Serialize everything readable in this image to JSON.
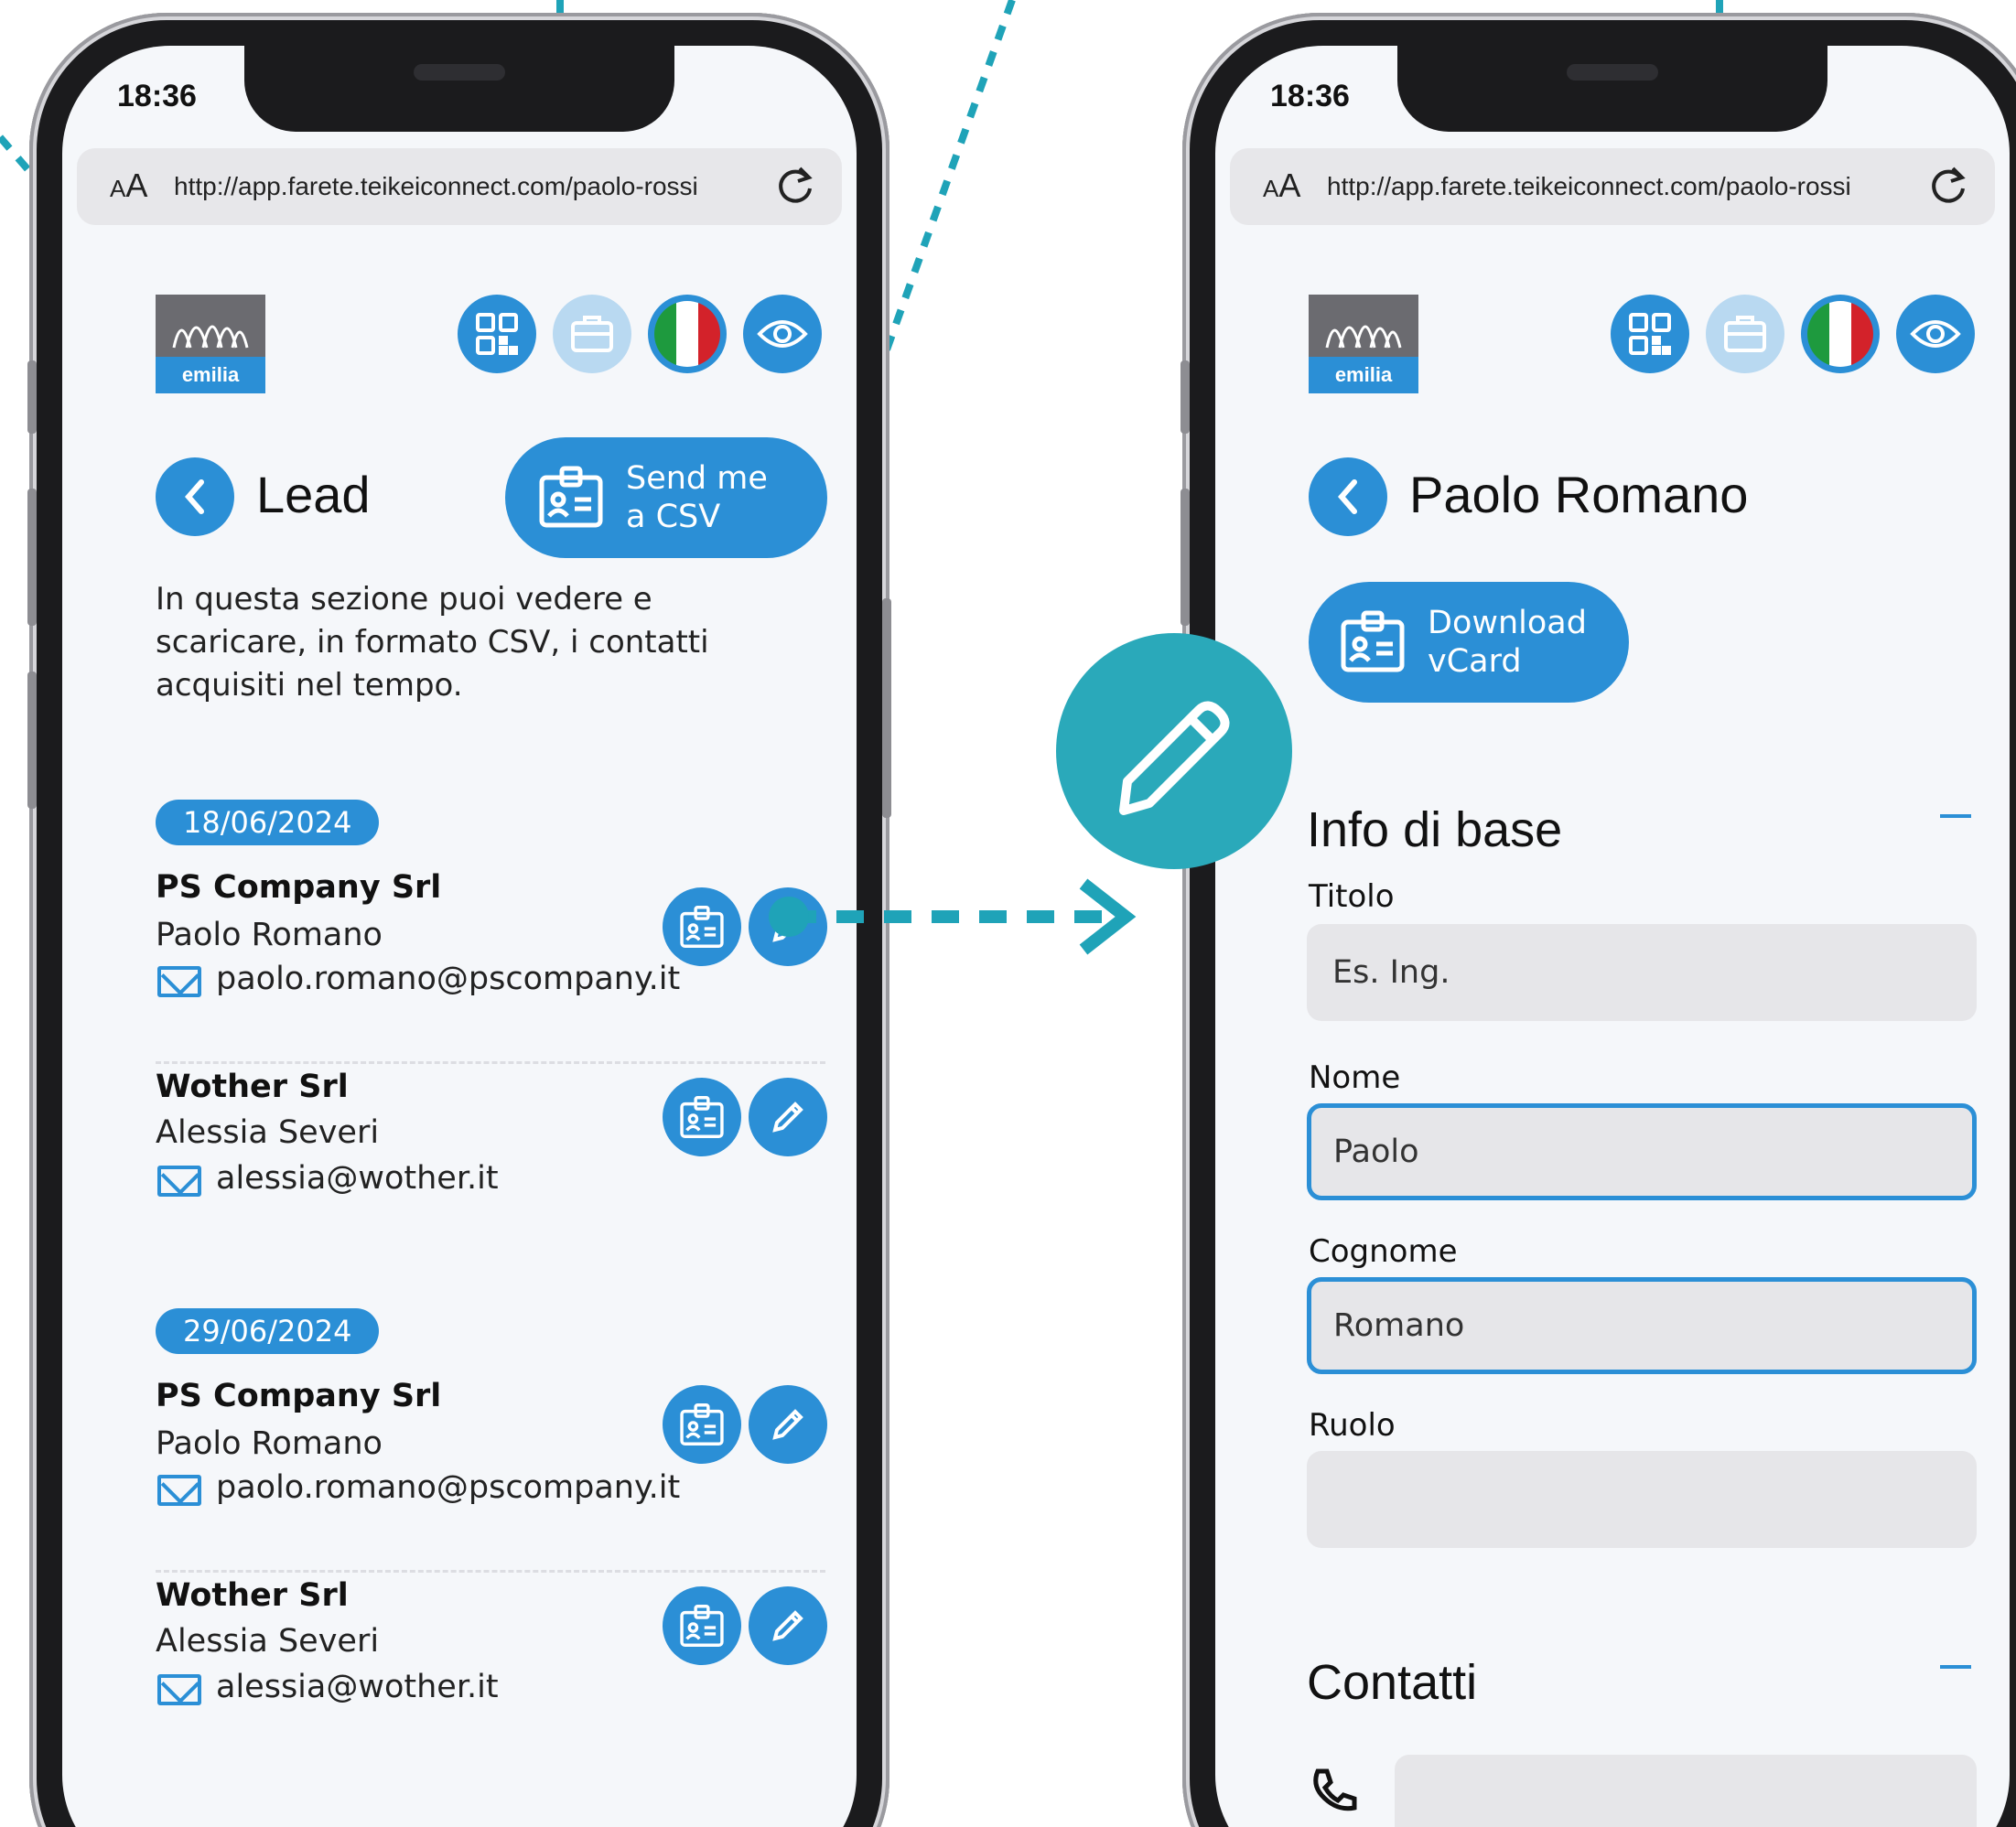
{
  "left_phone": {
    "status_time": "18:36",
    "browser": {
      "aa_small": "A",
      "aa_large": "A",
      "url": "http://app.farete.teikeiconnect.com/paolo-rossi"
    },
    "logo_text": "emilia",
    "page_title": "Lead",
    "csv_button": {
      "line1": "Send me",
      "line2": "a CSV"
    },
    "description": "In questa sezione puoi vedere e scaricare, in formato CSV, i contatti acquisiti nel tempo.",
    "groups": [
      {
        "date": "18/06/2024",
        "contacts": [
          {
            "company": "PS Company Srl",
            "person": "Paolo Romano",
            "email": "paolo.romano@pscompany.it"
          },
          {
            "company": "Wother Srl",
            "person": "Alessia Severi",
            "email": "alessia@wother.it"
          }
        ]
      },
      {
        "date": "29/06/2024",
        "contacts": [
          {
            "company": "PS Company Srl",
            "person": "Paolo Romano",
            "email": "paolo.romano@pscompany.it"
          },
          {
            "company": "Wother Srl",
            "person": "Alessia Severi",
            "email": "alessia@wother.it"
          }
        ]
      }
    ]
  },
  "right_phone": {
    "status_time": "18:36",
    "browser": {
      "aa_small": "A",
      "aa_large": "A",
      "url": "http://app.farete.teikeiconnect.com/paolo-rossi"
    },
    "logo_text": "emilia",
    "page_title": "Paolo Romano",
    "vcard_button": {
      "line1": "Download",
      "line2": "vCard"
    },
    "section_basic": "Info di base",
    "fields": {
      "titolo": {
        "label": "Titolo",
        "placeholder": "Es. Ing."
      },
      "nome": {
        "label": "Nome",
        "value": "Paolo"
      },
      "cognome": {
        "label": "Cognome",
        "value": "Romano"
      },
      "ruolo": {
        "label": "Ruolo",
        "value": ""
      }
    },
    "section_contacts": "Contatti"
  },
  "icons": [
    "qr-code-icon",
    "briefcase-icon",
    "italian-flag-icon",
    "eye-icon",
    "chevron-left-icon",
    "contact-card-icon",
    "pencil-icon",
    "mail-icon",
    "reload-icon",
    "phone-icon"
  ],
  "colors": {
    "accent": "#2b8fd6",
    "callout_teal": "#2aa9ba",
    "annotation": "#1fa3b8",
    "screen_bg": "#f5f7fa",
    "field_bg": "#e6e6e9"
  }
}
